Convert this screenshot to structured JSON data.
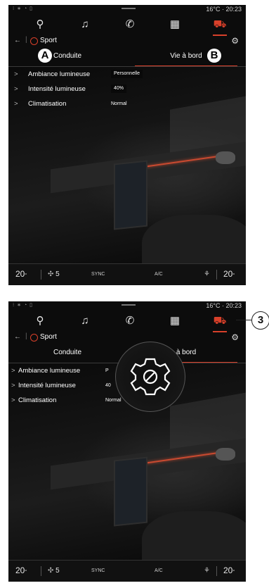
{
  "panel_top": {
    "status": {
      "temperature": "16°C",
      "time": "20:23"
    },
    "header": {
      "back": "←",
      "mode": "Sport"
    },
    "tabs": [
      "Conduite",
      "Vie à bord"
    ],
    "rows": [
      {
        "label": "Ambiance lumineuse",
        "value": "Personnelle"
      },
      {
        "label": "Intensité lumineuse",
        "value": "40%"
      },
      {
        "label": "Climatisation",
        "value": "Normal"
      }
    ],
    "bottom": {
      "temp_left": "20",
      "fan": "5",
      "sync": "SYNC",
      "ac": "A/C",
      "temp_right": "20"
    },
    "markers": {
      "a": "A",
      "b": "B"
    }
  },
  "panel_bottom": {
    "status": {
      "temperature": "16°C",
      "time": "20:23"
    },
    "header": {
      "back": "←",
      "mode": "Sport"
    },
    "tabs": [
      "Conduite",
      "à bord"
    ],
    "rows": [
      {
        "label": "Ambiance lumineuse",
        "value": "P"
      },
      {
        "label": "Intensité lumineuse",
        "value": "40"
      },
      {
        "label": "Climatisation",
        "value": "Normal"
      }
    ],
    "bottom": {
      "temp_left": "20",
      "fan": "5",
      "sync": "SYNC",
      "ac": "A/C",
      "temp_right": "20"
    },
    "callout": "3"
  },
  "icons": {
    "nav": "location-pin-icon",
    "music": "music-note-icon",
    "phone": "phone-icon",
    "apps": "apps-grid-icon",
    "car": "car-icon",
    "settings": "gear-icon"
  },
  "colors": {
    "accent": "#d8402a",
    "background": "#0c0c0c"
  }
}
